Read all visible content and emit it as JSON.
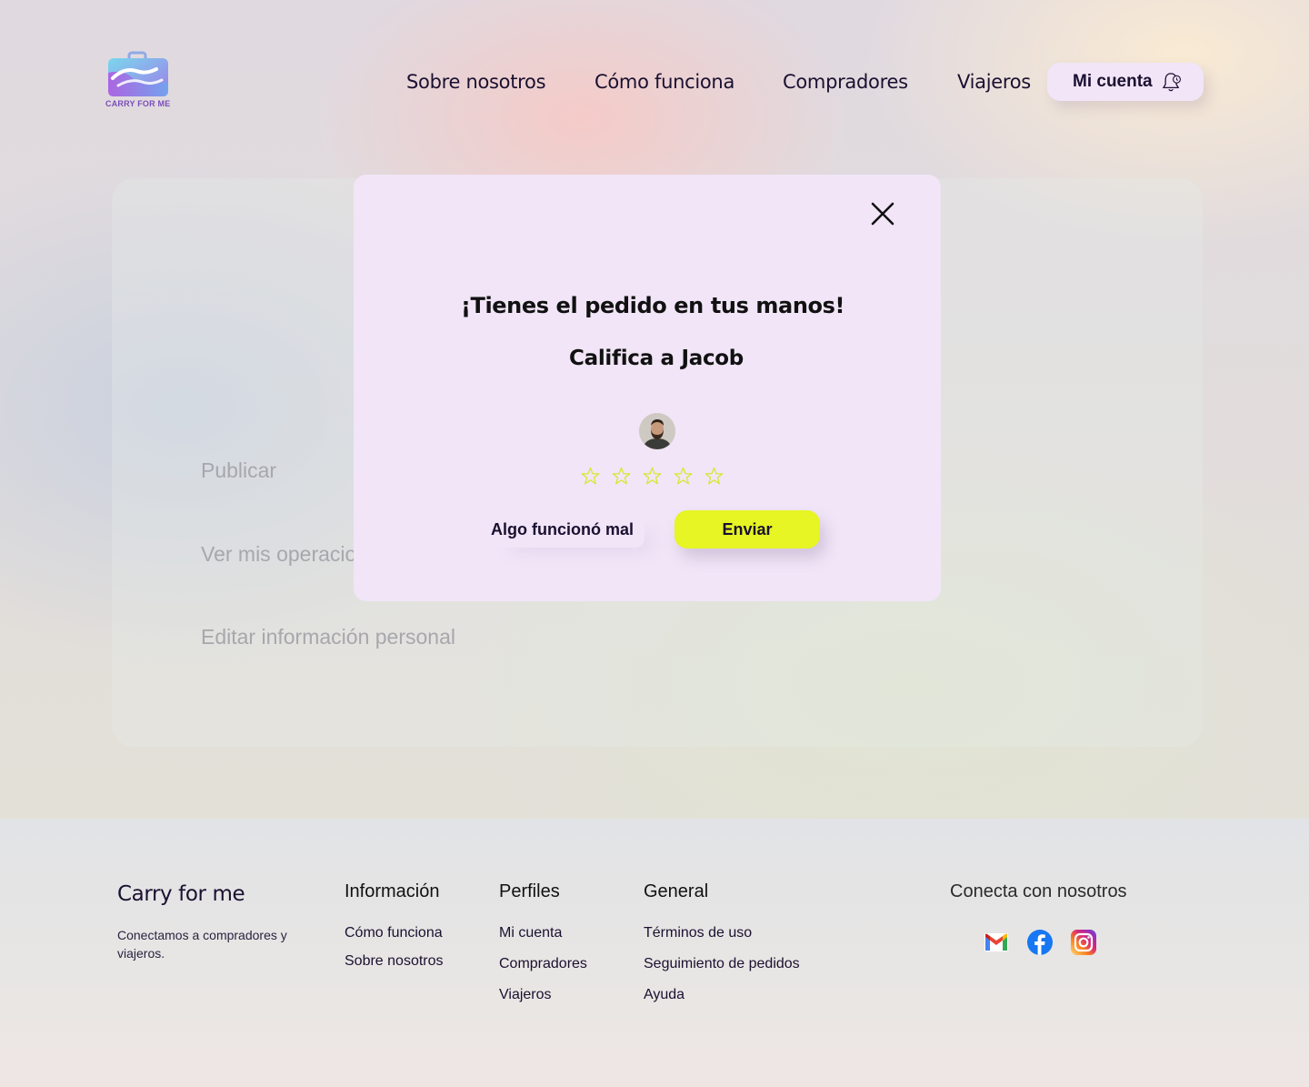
{
  "header": {
    "logo_text": "CARRY FOR ME",
    "nav": [
      "Sobre nosotros",
      "Cómo funciona",
      "Compradores",
      "Viajeros"
    ],
    "account_label": "Mi cuenta",
    "account_icon": "bell-icon"
  },
  "panel": {
    "menu": [
      "Publicar",
      "Ver mis operaciones",
      "Editar información personal"
    ]
  },
  "modal": {
    "title": "¡Tienes el pedido en tus manos!",
    "subtitle": "Califica a Jacob",
    "rating": 0,
    "max_rating": 5,
    "wrong_label": "Algo funcionó mal",
    "send_label": "Enviar",
    "send_color": "#e6f523",
    "close_icon": "close-icon"
  },
  "footer": {
    "brand": "Carry for me",
    "description": "Conectamos a compradores y viajeros.",
    "columns": [
      {
        "heading": "Información",
        "links": [
          "Cómo funciona",
          "Sobre nosotros"
        ]
      },
      {
        "heading": "Perfiles",
        "links": [
          "Mi cuenta",
          "Compradores",
          "Viajeros"
        ]
      },
      {
        "heading": "General",
        "links": [
          "Términos de uso",
          "Seguimiento de pedidos",
          "Ayuda"
        ]
      }
    ],
    "connect_heading": "Conecta con nosotros",
    "social": [
      "gmail-icon",
      "facebook-icon",
      "instagram-icon"
    ]
  }
}
